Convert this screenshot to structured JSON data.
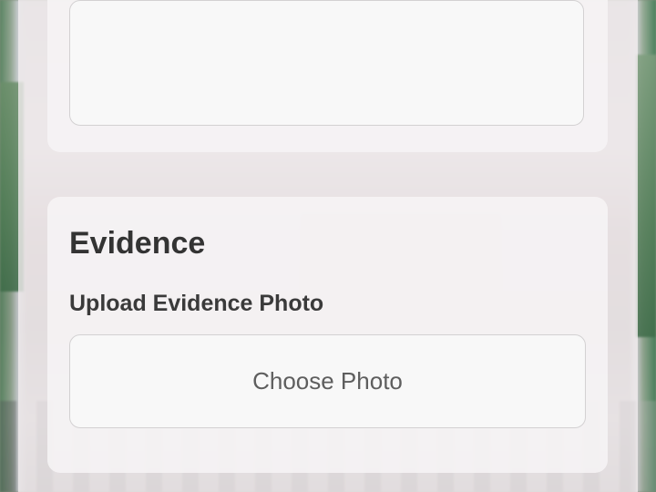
{
  "evidence": {
    "title": "Evidence",
    "upload_label": "Upload Evidence Photo",
    "choose_button_label": "Choose Photo"
  },
  "colors": {
    "card_background": "#f6f4f5",
    "field_border": "#d3d1d2",
    "title_text": "#333333",
    "button_text": "#5e5e5e"
  }
}
